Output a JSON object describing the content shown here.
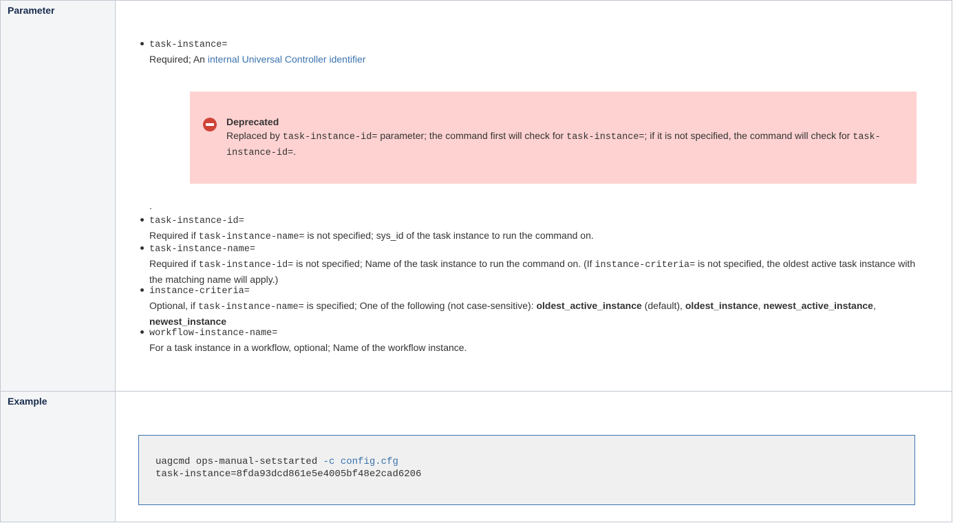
{
  "rows": {
    "parameter_header": "Parameter",
    "example_header": "Example"
  },
  "params": {
    "task_instance": {
      "name": "task-instance=",
      "desc_prefix": "Required; An ",
      "desc_link": "internal Universal Controller identifier"
    },
    "deprecated": {
      "title": "Deprecated",
      "t1": "Replaced by ",
      "c1": "task-instance-id=",
      "t2": " parameter; the command first will check for ",
      "c2": "task-instance=",
      "t3": "; if it is not specified, the command will check for ",
      "c3": "task-instance-id=",
      "t4": "."
    },
    "dot": ".",
    "task_instance_id": {
      "name": "task-instance-id=",
      "t1": "Required if ",
      "c1": "task-instance-name=",
      "t2": " is not specified; sys_id of the task instance to run the command on."
    },
    "task_instance_name": {
      "name": "task-instance-name=",
      "t1": "Required if ",
      "c1": "task-instance-id=",
      "t2": " is not specified; Name of the task instance to run the command on. (If ",
      "c2": "instance-criteria=",
      "t3": " is not specified, the oldest active task instance with the matching name will apply.)"
    },
    "instance_criteria": {
      "name": "instance-criteria=",
      "t1": "Optional, if ",
      "c1": "task-instance-name=",
      "t2": " is specified; One of the following (not case-sensitive): ",
      "b1": "oldest_active_instance",
      "t3": " (default), ",
      "b2": "oldest_instance",
      "t4": ", ",
      "b3": "newest_active_instance",
      "t5": ", ",
      "b4": "newest_instance"
    },
    "workflow_instance_name": {
      "name": "workflow-instance-name=",
      "desc": "For a task instance in a workflow, optional; Name of the workflow instance."
    }
  },
  "example": {
    "cmd": "uagcmd ops-manual-setstarted ",
    "flag": "-c config.cfg",
    "line2": "task-instance=8fda93dcd861e5e4005bf48e2cad6206"
  },
  "colors": {
    "link": "#3b73af",
    "header_bg": "#f4f5f7",
    "warning_bg": "#ffd2d2",
    "warning_icon": "#d04437",
    "code_bg": "#f0f0f0"
  }
}
